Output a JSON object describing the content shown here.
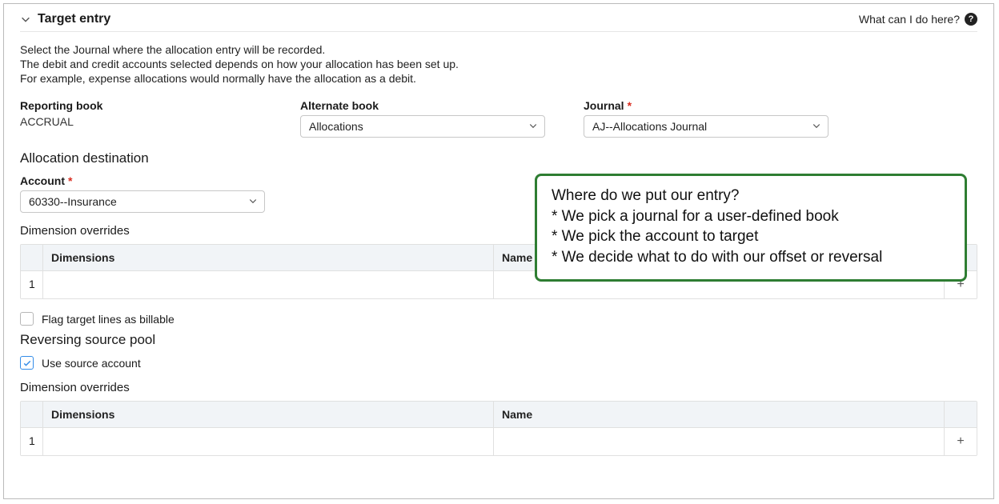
{
  "section": {
    "title": "Target entry"
  },
  "help": {
    "label": "What can I do here?"
  },
  "intro": {
    "line1": "Select the Journal where the allocation entry will be recorded.",
    "line2": "The debit and credit accounts selected depends on how your allocation has been set up.",
    "line3": "For example, expense allocations would normally have the allocation as a debit."
  },
  "fields": {
    "reporting_book": {
      "label": "Reporting book",
      "value": "ACCRUAL"
    },
    "alternate_book": {
      "label": "Alternate book",
      "value": "Allocations"
    },
    "journal": {
      "label": "Journal",
      "value": "AJ--Allocations Journal"
    }
  },
  "allocation_destination": {
    "heading": "Allocation destination",
    "account": {
      "label": "Account",
      "value": "60330--Insurance"
    },
    "dimension_overrides_heading": "Dimension overrides",
    "table": {
      "col_dimensions": "Dimensions",
      "col_name": "Name",
      "row1_num": "1"
    }
  },
  "flag_billable": {
    "label": "Flag target lines as billable",
    "checked": false
  },
  "reversing": {
    "heading": "Reversing source pool",
    "use_source": {
      "label": "Use source account",
      "checked": true
    },
    "dimension_overrides_heading": "Dimension overrides",
    "table": {
      "col_dimensions": "Dimensions",
      "col_name": "Name",
      "row1_num": "1"
    }
  },
  "callout": {
    "title": "Where do we put our entry?",
    "b1": "* We pick a journal for a user-defined book",
    "b2": "* We pick the account to target",
    "b3": "* We decide what to do with our offset or reversal"
  }
}
